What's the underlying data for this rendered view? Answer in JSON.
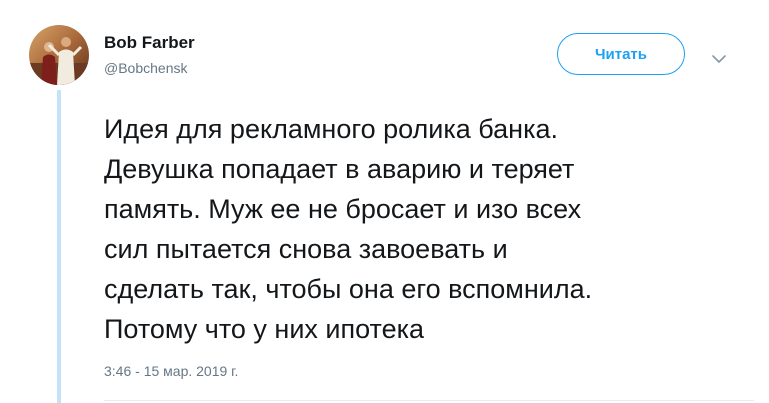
{
  "author": {
    "name": "Bob Farber",
    "handle": "@Bobchensk",
    "avatar_icon": "profile-photo-avatar"
  },
  "follow_button": {
    "label": "Читать",
    "color": "#1da1f2"
  },
  "menu": {
    "icon": "chevron-down-icon"
  },
  "tweet": {
    "lines": [
      "Идея для рекламного ролика банка.",
      "Девушка попадает в аварию и теряет",
      "память. Муж ее не бросает и изо всех",
      "сил пытается снова завоевать и",
      "сделать так, чтобы она его вспомнила.",
      "Потому что у них ипотека"
    ],
    "timestamp": "3:46 - 15 мар. 2019 г."
  },
  "colors": {
    "accent": "#1da1f2",
    "thread_line": "#c4e3f7",
    "secondary_text": "#657786",
    "primary_text": "#14171a"
  }
}
